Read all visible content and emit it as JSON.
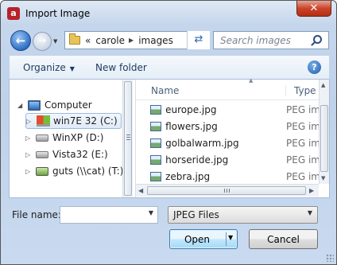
{
  "window": {
    "title": "Import Image",
    "app_icon": "acrobat-icon",
    "close_label": "✕"
  },
  "address": {
    "overflow": "«",
    "segments": [
      "carole",
      "images"
    ],
    "refresh_icon": "↺⇄"
  },
  "search": {
    "placeholder": "Search images"
  },
  "toolbar": {
    "organize_label": "Organize",
    "new_folder_label": "New folder",
    "help_label": "?"
  },
  "nav_tree": {
    "computer_label": "Computer",
    "drives": [
      {
        "label": "win7E 32 (C:)",
        "icon": "windows-drive-icon",
        "selected": true
      },
      {
        "label": "WinXP (D:)",
        "icon": "drive-icon",
        "selected": false
      },
      {
        "label": "Vista32 (E:)",
        "icon": "drive-icon",
        "selected": false
      },
      {
        "label": "guts (\\\\cat) (T:)",
        "icon": "network-drive-icon",
        "selected": false
      }
    ]
  },
  "file_list": {
    "columns": {
      "name": "Name",
      "type": "Type"
    },
    "files": [
      {
        "name": "europe.jpg",
        "type": "PEG im"
      },
      {
        "name": "flowers.jpg",
        "type": "PEG im"
      },
      {
        "name": "golbalwarm.jpg",
        "type": "PEG im"
      },
      {
        "name": "horseride.jpg",
        "type": "PEG im"
      },
      {
        "name": "zebra.jpg",
        "type": "PEG im"
      }
    ]
  },
  "footer": {
    "filename_label": "File name:",
    "filename_value": "",
    "filetype_value": "JPEG Files",
    "open_label": "Open",
    "cancel_label": "Cancel"
  }
}
